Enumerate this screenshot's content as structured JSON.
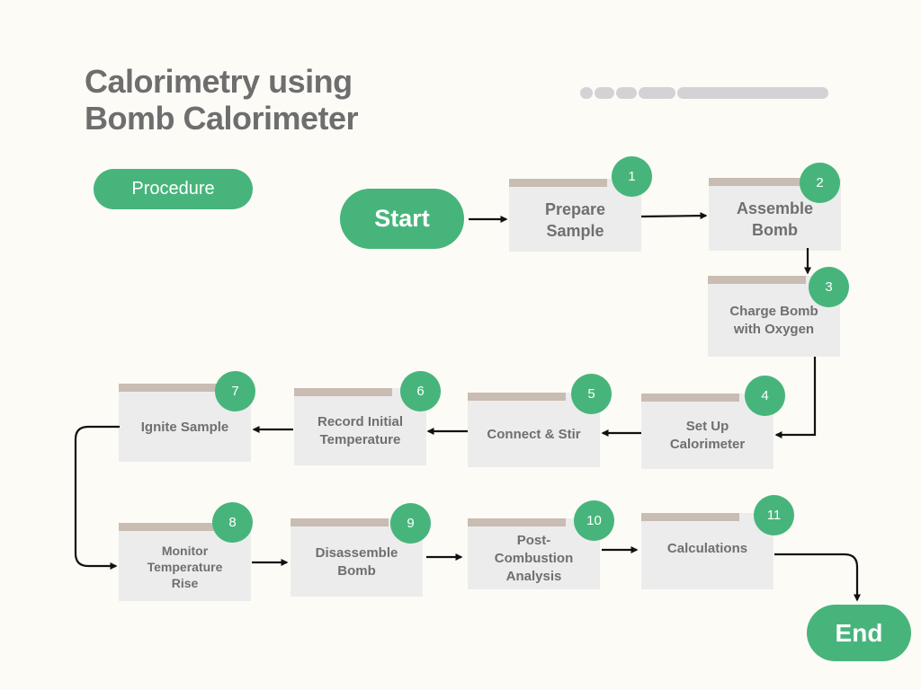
{
  "title": "Calorimetry using\nBomb Calorimeter",
  "tag_label": "Procedure",
  "start_label": "Start",
  "end_label": "End",
  "steps": [
    {
      "number": "1",
      "label": "Prepare\nSample"
    },
    {
      "number": "2",
      "label": "Assemble\nBomb"
    },
    {
      "number": "3",
      "label": "Charge Bomb\nwith Oxygen"
    },
    {
      "number": "4",
      "label": "Set Up\nCalorimeter"
    },
    {
      "number": "5",
      "label": "Connect & Stir"
    },
    {
      "number": "6",
      "label": "Record Initial\nTemperature"
    },
    {
      "number": "7",
      "label": "Ignite Sample"
    },
    {
      "number": "8",
      "label": "Monitor\nTemperature\nRise"
    },
    {
      "number": "9",
      "label": "Disassemble\nBomb"
    },
    {
      "number": "10",
      "label": "Post-\nCombustion\nAnalysis"
    },
    {
      "number": "11",
      "label": "Calculations"
    }
  ],
  "colors": {
    "accent_green": "#47b57b",
    "step_fill": "#ececec",
    "step_bar": "#c9bcb3",
    "title_text": "#6e6e6e",
    "background": "#fdfbf6"
  }
}
